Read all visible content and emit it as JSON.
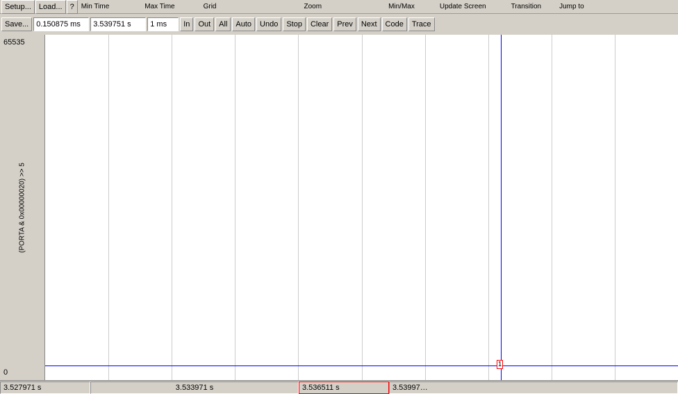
{
  "toolbar": {
    "top_row": {
      "setup_label": "Setup...",
      "load_label": "Load...",
      "help_label": "?",
      "save_label": "Save...",
      "min_time_label": "Min Time",
      "min_time_value": "0.150875 ms",
      "max_time_label": "Max Time",
      "max_time_value": "3.539751 s",
      "grid_label": "Grid",
      "grid_value": "1 ms",
      "zoom_label": "Zoom",
      "zoom_in": "In",
      "zoom_out": "Out",
      "zoom_all": "All",
      "zoom_auto": "Auto",
      "zoom_undo": "Undo",
      "minmax_label": "Min/Max",
      "update_screen_label": "Update Screen",
      "stop_label": "Stop",
      "clear_label": "Clear",
      "transition_label": "Transition",
      "prev_label": "Prev",
      "next_label": "Next",
      "jump_to_label": "Jump to",
      "code_label": "Code",
      "trace_label": "Trace"
    }
  },
  "signal": {
    "label": "(PORTA & 0x00000020) >> 5",
    "value_top": "65535",
    "value_bottom": "0"
  },
  "status_bar": {
    "time1": "3.527971 s",
    "time2": "3.533971 s",
    "time3": "3.536511 s",
    "time4": "3.53997…"
  },
  "cursor": {
    "marker": "1",
    "line_pct": 72
  },
  "grid_lines": [
    10,
    20,
    30,
    40,
    50,
    60,
    70,
    80,
    90
  ]
}
